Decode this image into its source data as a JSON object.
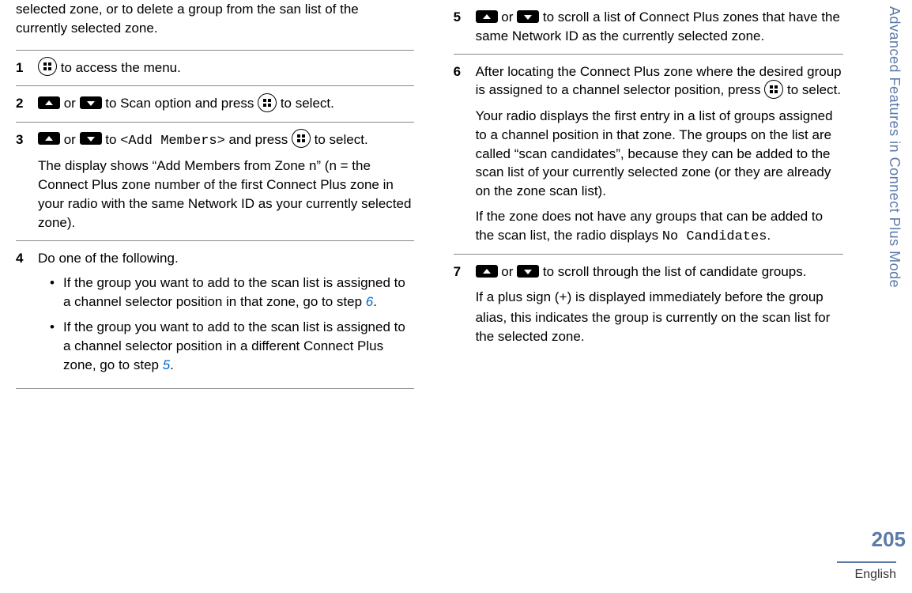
{
  "sidebar": {
    "section_title": "Advanced Features in Connect Plus Mode",
    "page_number": "205",
    "language": "English"
  },
  "left_column": {
    "intro": "selected zone, or to delete a group from the san list of the currently selected zone.",
    "steps": [
      {
        "num": "1",
        "before": "",
        "after": " to access the menu."
      },
      {
        "num": "2",
        "mid1": " or ",
        "mid2": " to Scan option and press ",
        "after": " to select."
      },
      {
        "num": "3",
        "mid1": " or ",
        "mid2": " to ",
        "add_members": "<Add Members>",
        "mid3": " and press ",
        "after": " to select.",
        "para2": "The display shows “Add Members from Zone n” (n = the Connect Plus zone number of the first Connect Plus zone in your radio with the same Network ID as your currently selected zone)."
      },
      {
        "num": "4",
        "intro": "Do one of the following.",
        "bullets": [
          {
            "text": "If the group you want to add to the scan list is assigned to a channel selector position in that zone, go to step ",
            "link": "6",
            "after": "."
          },
          {
            "text": "If the group you want to add to the scan list is assigned to a channel selector position in a different Connect Plus zone, go to step ",
            "link": "5",
            "after": "."
          }
        ]
      }
    ]
  },
  "right_column": {
    "steps": [
      {
        "num": "5",
        "mid1": " or ",
        "after": " to scroll a list of Connect Plus zones that have the same Network ID as the currently selected zone."
      },
      {
        "num": "6",
        "line1a": "After locating the Connect Plus zone where the desired group is assigned to a channel selector position, press ",
        "line1b": " to select.",
        "para2": "Your radio displays the first entry in a list of groups assigned to a channel position in that zone. The groups on the list are called “scan candidates”, because they can be added to the scan list of your currently selected zone (or they are already on the zone scan list).",
        "para3a": "If the zone does not have any groups that can be added to the scan list, the radio displays ",
        "no_candidates": "No Candidates",
        "para3b": "."
      },
      {
        "num": "7",
        "mid1": " or ",
        "after": " to scroll through the list of candidate groups.",
        "para2a": "If a plus sign (",
        "plus": "+",
        "para2b": ") is displayed immediately before the group alias, this indicates the group is currently on the scan list for the selected zone."
      }
    ]
  }
}
